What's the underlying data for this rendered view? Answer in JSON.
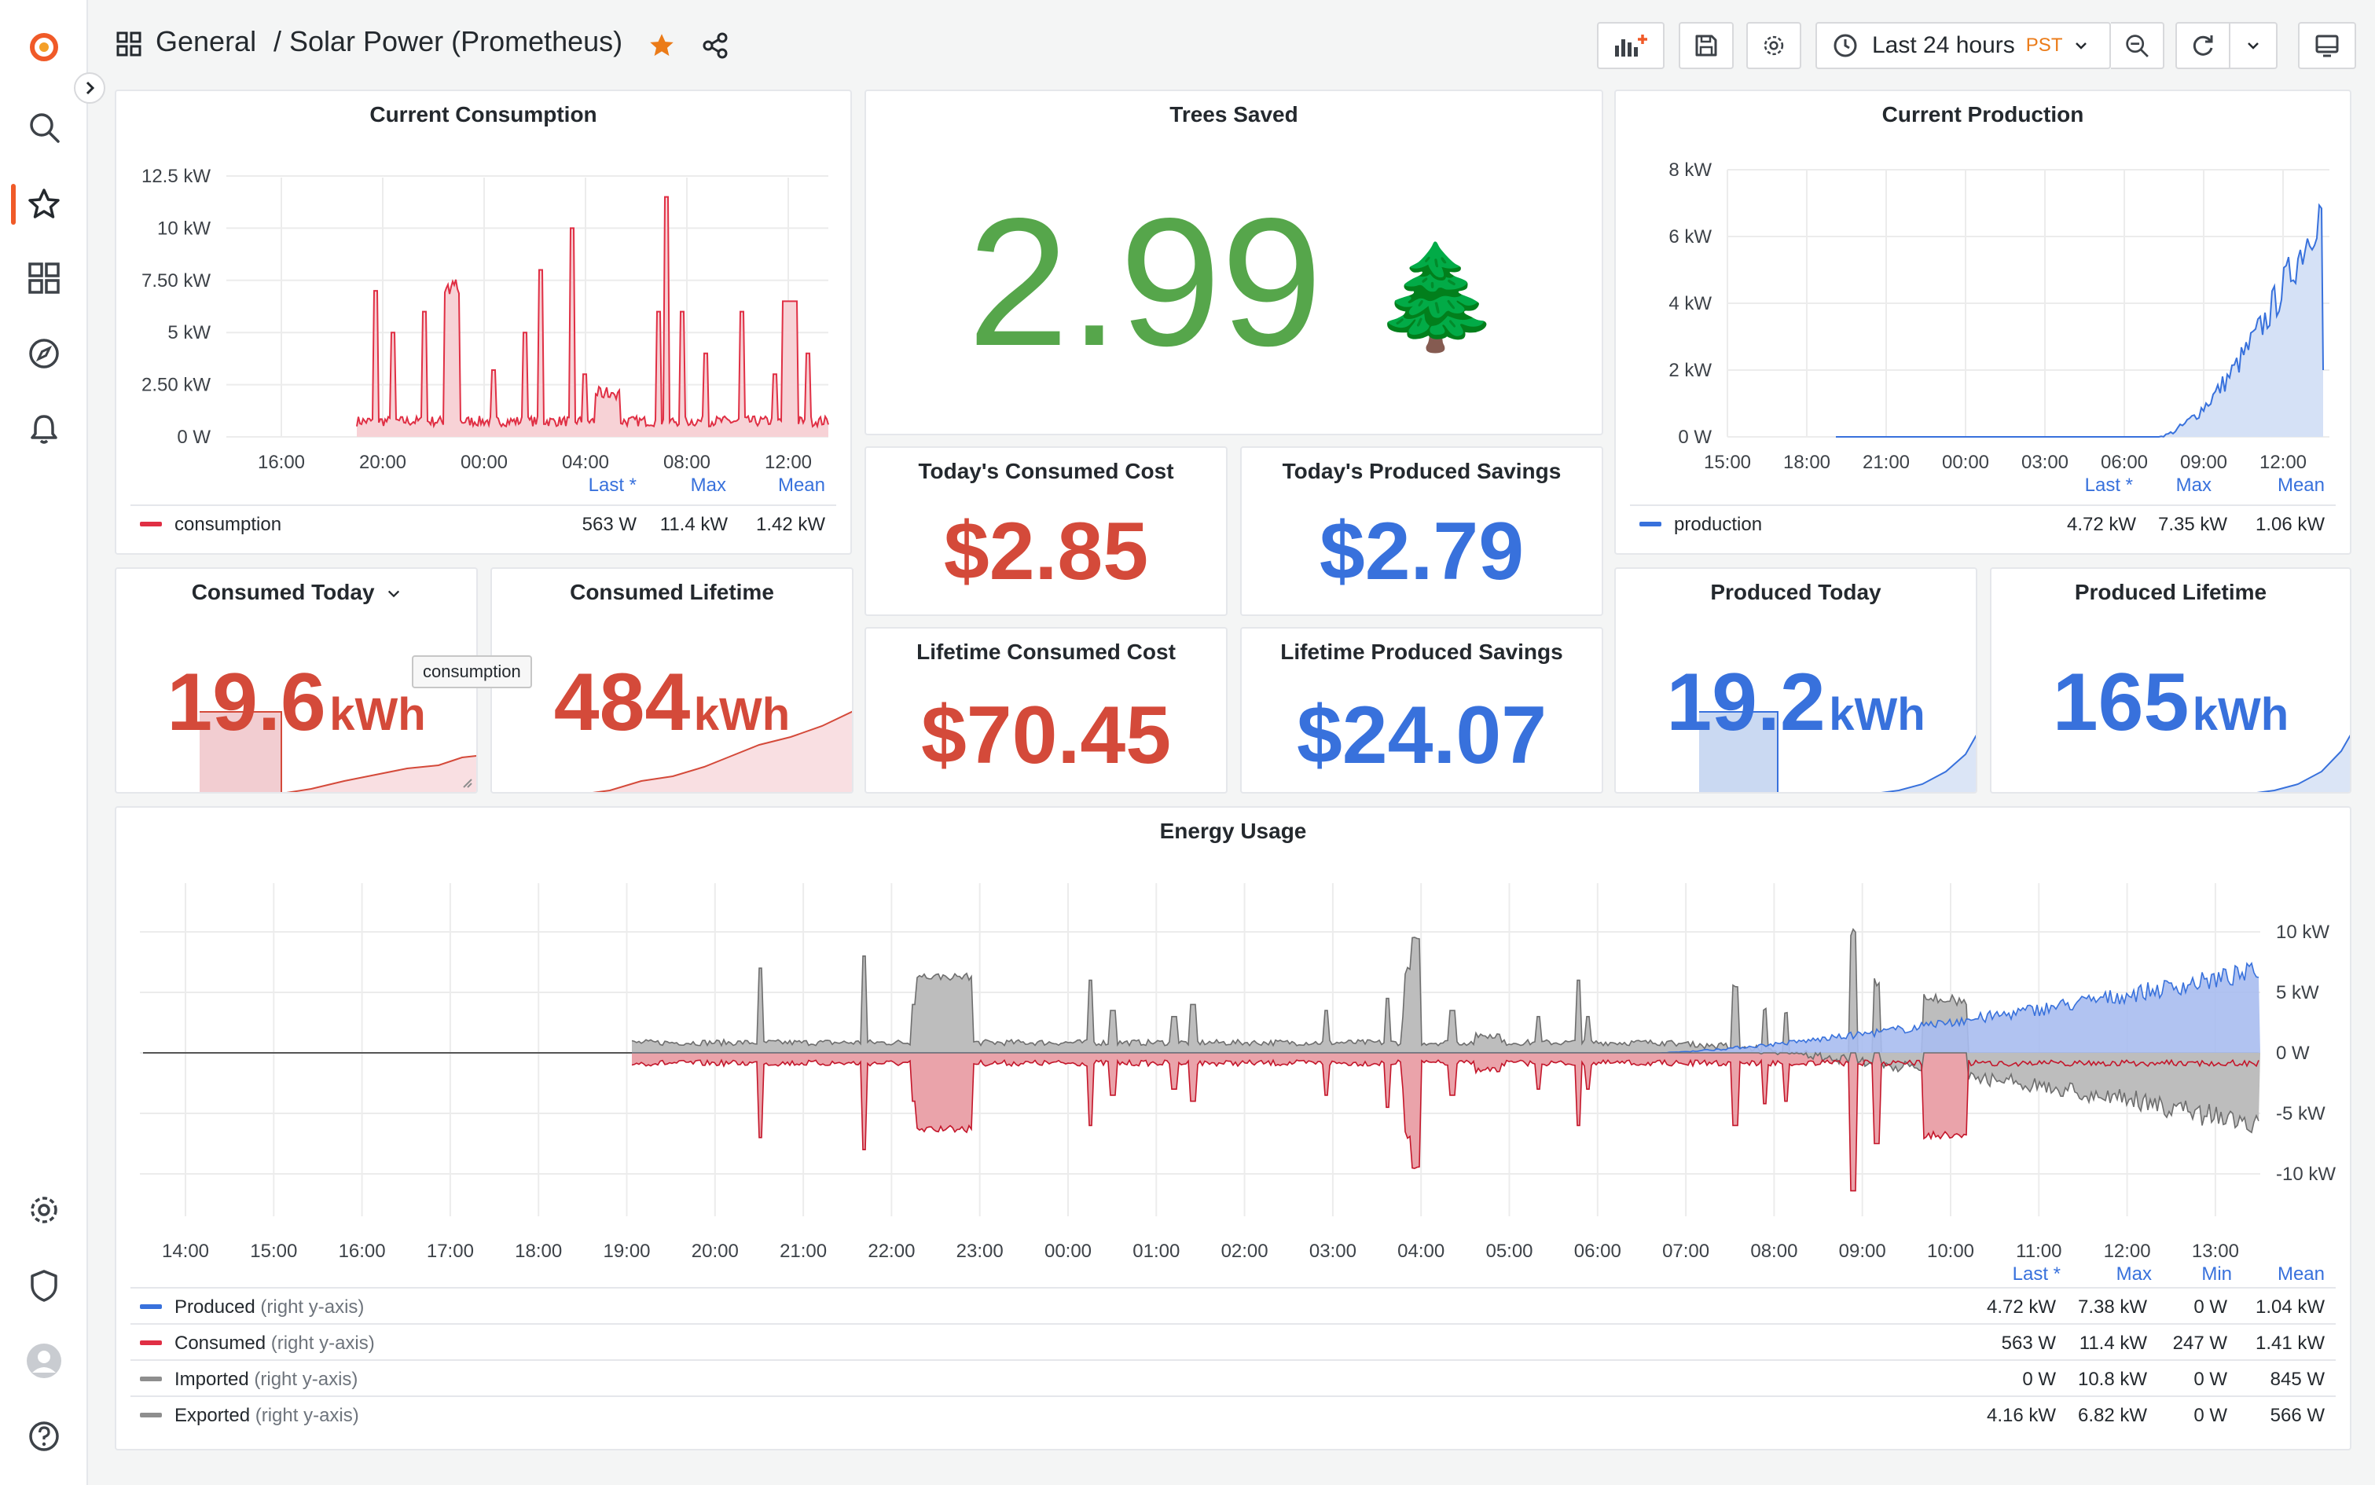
{
  "breadcrumb": {
    "folder": "General",
    "sep": "/",
    "dashboard": "Solar Power (Prometheus)"
  },
  "time_picker": {
    "label": "Last 24 hours",
    "tz": "PST"
  },
  "sidebar": {
    "icons": [
      "grafana-logo-icon",
      "search-icon",
      "starred-icon",
      "dashboards-icon",
      "explore-icon",
      "alerting-icon",
      "settings-icon",
      "shield-icon",
      "avatar",
      "help-icon"
    ]
  },
  "panels": {
    "current_consumption": {
      "title": "Current Consumption",
      "y_ticks": [
        "12.5 kW",
        "10 kW",
        "7.50 kW",
        "5 kW",
        "2.50 kW",
        "0 W"
      ],
      "x_ticks": [
        "16:00",
        "20:00",
        "00:00",
        "04:00",
        "08:00",
        "12:00"
      ],
      "legend_headers": [
        "Last *",
        "Max",
        "Mean"
      ],
      "series": "consumption",
      "values": [
        "563 W",
        "11.4 kW",
        "1.42 kW"
      ],
      "color": "#e02f44"
    },
    "trees_saved": {
      "title": "Trees Saved",
      "value": "2.99",
      "emoji": "🌲",
      "color": "#56a64b"
    },
    "current_production": {
      "title": "Current Production",
      "y_ticks": [
        "8 kW",
        "6 kW",
        "4 kW",
        "2 kW",
        "0 W"
      ],
      "x_ticks": [
        "15:00",
        "18:00",
        "21:00",
        "00:00",
        "03:00",
        "06:00",
        "09:00",
        "12:00"
      ],
      "legend_headers": [
        "Last *",
        "Max",
        "Mean"
      ],
      "series": "production",
      "values": [
        "4.72 kW",
        "7.35 kW",
        "1.06 kW"
      ],
      "color": "#3871dc"
    },
    "todays_consumed_cost": {
      "title": "Today's Consumed Cost",
      "value": "$2.85"
    },
    "todays_produced_savings": {
      "title": "Today's Produced Savings",
      "value": "$2.79"
    },
    "lifetime_consumed_cost": {
      "title": "Lifetime Consumed Cost",
      "value": "$70.45"
    },
    "lifetime_produced_savings": {
      "title": "Lifetime Produced Savings",
      "value": "$24.07"
    },
    "consumed_today": {
      "title": "Consumed Today",
      "value": "19.6",
      "unit": "kWh",
      "tooltip": "consumption"
    },
    "consumed_lifetime": {
      "title": "Consumed Lifetime",
      "value": "484",
      "unit": "kWh"
    },
    "produced_today": {
      "title": "Produced Today",
      "value": "19.2",
      "unit": "kWh"
    },
    "produced_lifetime": {
      "title": "Produced Lifetime",
      "value": "165",
      "unit": "kWh"
    },
    "energy_usage": {
      "title": "Energy Usage",
      "y_ticks": [
        "10 kW",
        "5 kW",
        "0 W",
        "-5 kW",
        "-10 kW"
      ],
      "x_ticks": [
        "14:00",
        "15:00",
        "16:00",
        "17:00",
        "18:00",
        "19:00",
        "20:00",
        "21:00",
        "22:00",
        "23:00",
        "00:00",
        "01:00",
        "02:00",
        "03:00",
        "04:00",
        "05:00",
        "06:00",
        "07:00",
        "08:00",
        "09:00",
        "10:00",
        "11:00",
        "12:00",
        "13:00"
      ],
      "legend_headers": [
        "Last *",
        "Max",
        "Min",
        "Mean"
      ],
      "rows": [
        {
          "name": "Produced",
          "suffix": "(right y-axis)",
          "color": "#3871dc",
          "values": [
            "4.72 kW",
            "7.38 kW",
            "0 W",
            "1.04 kW"
          ]
        },
        {
          "name": "Consumed",
          "suffix": "(right y-axis)",
          "color": "#e02f44",
          "values": [
            "563 W",
            "11.4 kW",
            "247 W",
            "1.41 kW"
          ]
        },
        {
          "name": "Imported",
          "suffix": "(right y-axis)",
          "color": "#8e8e8e",
          "values": [
            "0 W",
            "10.8 kW",
            "0 W",
            "845 W"
          ]
        },
        {
          "name": "Exported",
          "suffix": "(right y-axis)",
          "color": "#8e8e8e",
          "values": [
            "4.16 kW",
            "6.82 kW",
            "0 W",
            "566 W"
          ]
        }
      ]
    }
  },
  "colors": {
    "red": "#d44a3a",
    "blue": "#3871dc",
    "green": "#56a64b",
    "accent": "#f05a28"
  }
}
